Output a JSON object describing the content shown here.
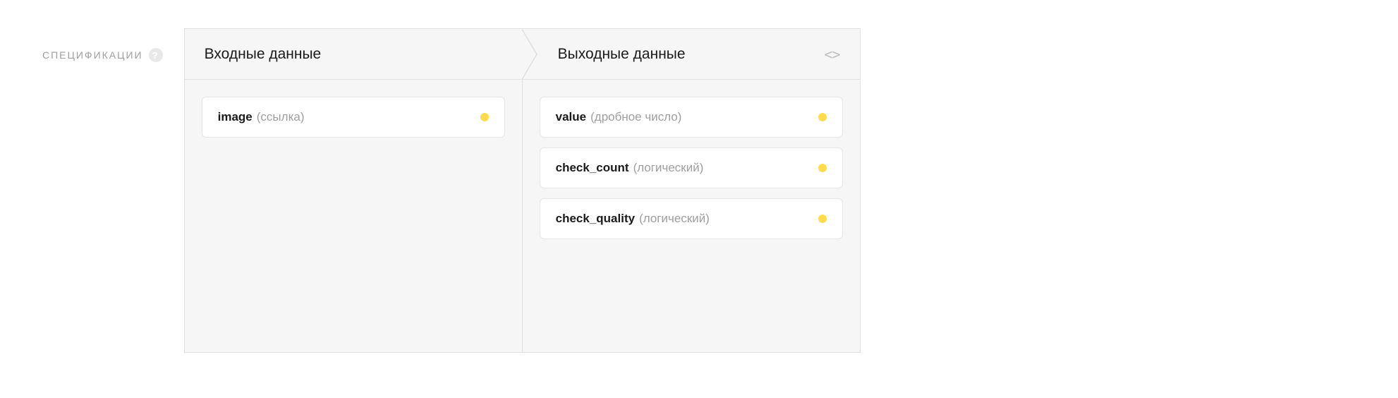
{
  "section_label": "СПЕЦИФИКАЦИИ",
  "help_glyph": "?",
  "code_glyph_left": "<",
  "code_glyph_right": ">",
  "panels": {
    "input": {
      "title": "Входные данные",
      "fields": [
        {
          "name": "image",
          "type": "(ссылка)"
        }
      ]
    },
    "output": {
      "title": "Выходные данные",
      "fields": [
        {
          "name": "value",
          "type": "(дробное число)"
        },
        {
          "name": "check_count",
          "type": "(логический)"
        },
        {
          "name": "check_quality",
          "type": "(логический)"
        }
      ]
    }
  }
}
